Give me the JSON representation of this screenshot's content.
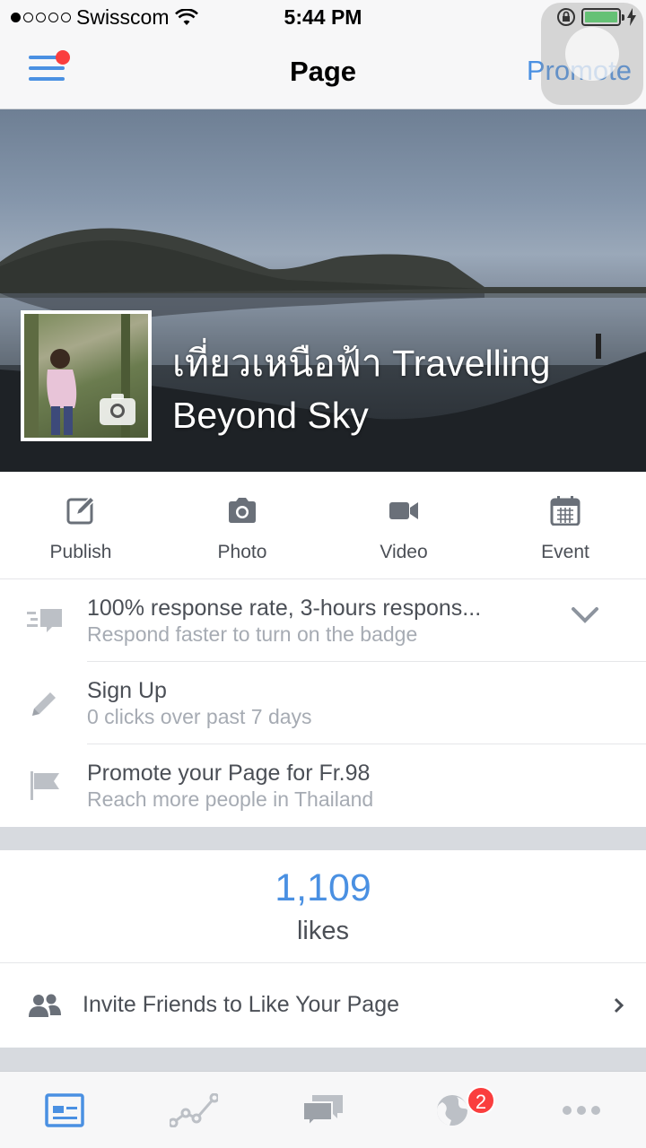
{
  "status_bar": {
    "carrier": "Swisscom",
    "time": "5:44 PM",
    "signal_bars_filled": 1,
    "signal_bars_total": 5,
    "battery_level": 1.0,
    "battery_color": "#4cd964"
  },
  "nav": {
    "title": "Page",
    "promote_label": "Promote",
    "accent_color": "#4a90e2"
  },
  "cover": {
    "page_name": "เที่ยวเหนือฟ้า Travelling Beyond Sky"
  },
  "actions": [
    {
      "label": "Publish",
      "icon": "compose-icon"
    },
    {
      "label": "Photo",
      "icon": "camera-icon"
    },
    {
      "label": "Video",
      "icon": "video-camera-icon"
    },
    {
      "label": "Event",
      "icon": "calendar-icon"
    }
  ],
  "insights": [
    {
      "title": "100% response rate, 3-hours respons...",
      "subtitle": "Respond faster to turn on the badge",
      "icon": "message-bubble-icon"
    },
    {
      "title": "Sign Up",
      "subtitle": "0 clicks over past 7 days",
      "icon": "pencil-icon"
    },
    {
      "title": "Promote your Page for Fr.98",
      "subtitle": "Reach more people in Thailand",
      "icon": "flag-icon"
    }
  ],
  "likes": {
    "count": "1,109",
    "label": "likes"
  },
  "invite": {
    "label": "Invite Friends to Like Your Page"
  },
  "tab_bar": {
    "tabs": [
      "page-icon",
      "insights-icon",
      "messages-icon",
      "notifications-globe-icon",
      "more-icon"
    ],
    "notifications_badge": "2"
  }
}
